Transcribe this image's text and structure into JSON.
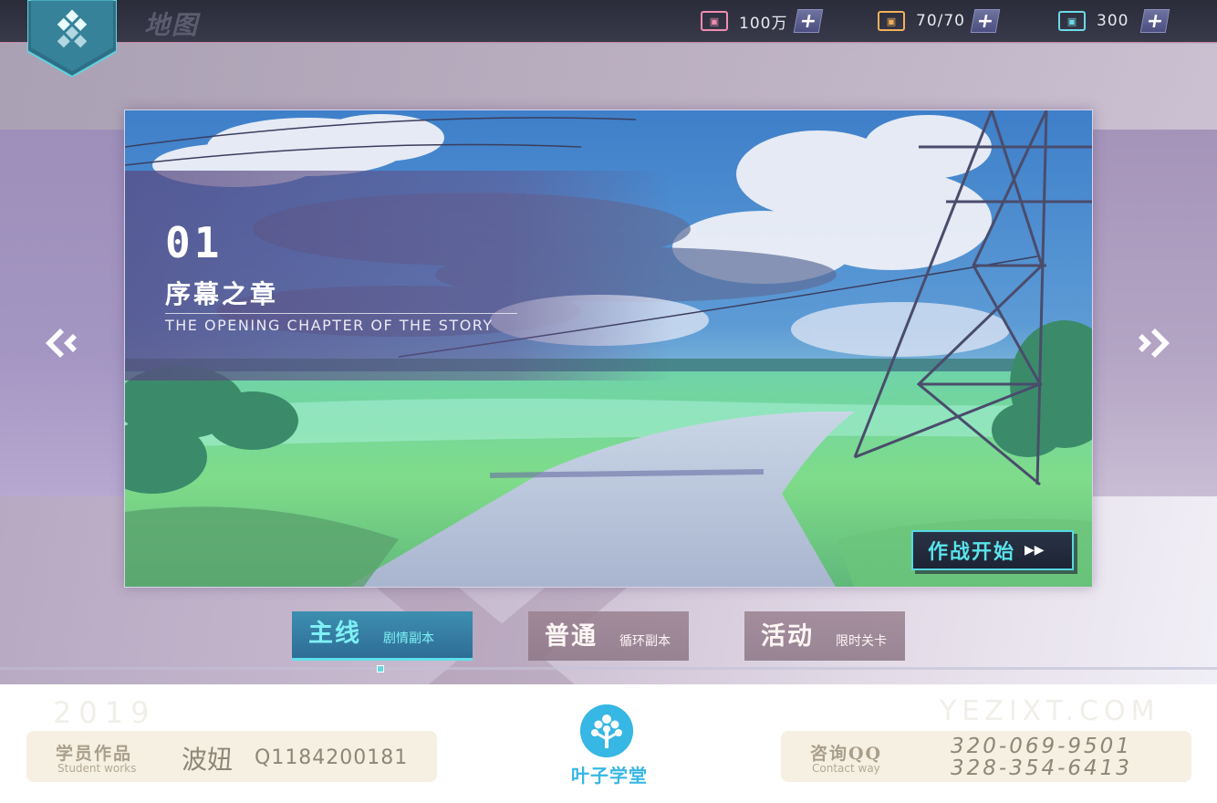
{
  "header": {
    "title": "地图",
    "resources": [
      {
        "icon": "coin-icon",
        "value": "100万",
        "color": "#f08cb0"
      },
      {
        "icon": "stamina-icon",
        "value": "70/70",
        "color": "#f2b05a"
      },
      {
        "icon": "gem-icon",
        "value": "300",
        "color": "#6fd8e8"
      }
    ]
  },
  "stage": {
    "number": "01",
    "name": "序幕之章",
    "subtitle": "THE OPENING CHAPTER OF THE STORY",
    "start_label": "作战开始",
    "start_arrow": "▶▶"
  },
  "tabs": [
    {
      "main": "主线",
      "sub": "剧情副本",
      "active": true
    },
    {
      "main": "普通",
      "sub": "循环副本",
      "active": false
    },
    {
      "main": "活动",
      "sub": "限时关卡",
      "active": false
    }
  ],
  "footer": {
    "year": "2019",
    "site": "YEZIXT.COM",
    "student_label_cn": "学员作品",
    "student_label_en": "Student works",
    "student_name": "波妞",
    "student_qq": "Q1184200181",
    "contact_label_cn": "咨询QQ",
    "contact_label_en": "Contact way",
    "phone_1": "320-069-9501",
    "phone_2": "328-354-6413",
    "brand": "叶子学堂"
  },
  "colors": {
    "accent_cyan": "#59e3ea",
    "tab_active": "#2f6d96",
    "brand_blue": "#37b7e3"
  }
}
